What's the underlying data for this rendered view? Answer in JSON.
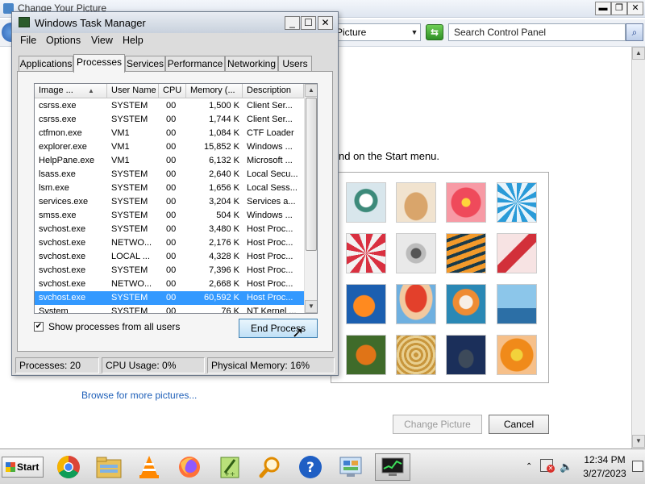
{
  "control_panel": {
    "window_title": "Change Your Picture",
    "address_text": "Picture",
    "search_placeholder": "Search Control Panel",
    "instruction": "nd on the Start menu.",
    "browse_link": "Browse for more pictures...",
    "change_button": "Change Picture",
    "cancel_button": "Cancel"
  },
  "task_manager": {
    "title": "Windows Task Manager",
    "menu": [
      "File",
      "Options",
      "View",
      "Help"
    ],
    "tabs": [
      "Applications",
      "Processes",
      "Services",
      "Performance",
      "Networking",
      "Users"
    ],
    "active_tab": "Processes",
    "columns": [
      "Image ...",
      "User Name",
      "CPU",
      "Memory (...",
      "Description"
    ],
    "processes": [
      {
        "image": "csrss.exe",
        "user": "SYSTEM",
        "cpu": "00",
        "memory": "1,500 K",
        "desc": "Client Ser..."
      },
      {
        "image": "csrss.exe",
        "user": "SYSTEM",
        "cpu": "00",
        "memory": "1,744 K",
        "desc": "Client Ser..."
      },
      {
        "image": "ctfmon.exe",
        "user": "VM1",
        "cpu": "00",
        "memory": "1,084 K",
        "desc": "CTF Loader"
      },
      {
        "image": "explorer.exe",
        "user": "VM1",
        "cpu": "00",
        "memory": "15,852 K",
        "desc": "Windows ..."
      },
      {
        "image": "HelpPane.exe",
        "user": "VM1",
        "cpu": "00",
        "memory": "6,132 K",
        "desc": "Microsoft ..."
      },
      {
        "image": "lsass.exe",
        "user": "SYSTEM",
        "cpu": "00",
        "memory": "2,640 K",
        "desc": "Local Secu..."
      },
      {
        "image": "lsm.exe",
        "user": "SYSTEM",
        "cpu": "00",
        "memory": "1,656 K",
        "desc": "Local Sess..."
      },
      {
        "image": "services.exe",
        "user": "SYSTEM",
        "cpu": "00",
        "memory": "3,204 K",
        "desc": "Services a..."
      },
      {
        "image": "smss.exe",
        "user": "SYSTEM",
        "cpu": "00",
        "memory": "504 K",
        "desc": "Windows ..."
      },
      {
        "image": "svchost.exe",
        "user": "SYSTEM",
        "cpu": "00",
        "memory": "3,480 K",
        "desc": "Host Proc..."
      },
      {
        "image": "svchost.exe",
        "user": "NETWO...",
        "cpu": "00",
        "memory": "2,176 K",
        "desc": "Host Proc..."
      },
      {
        "image": "svchost.exe",
        "user": "LOCAL ...",
        "cpu": "00",
        "memory": "4,328 K",
        "desc": "Host Proc..."
      },
      {
        "image": "svchost.exe",
        "user": "SYSTEM",
        "cpu": "00",
        "memory": "7,396 K",
        "desc": "Host Proc..."
      },
      {
        "image": "svchost.exe",
        "user": "NETWO...",
        "cpu": "00",
        "memory": "2,668 K",
        "desc": "Host Proc..."
      },
      {
        "image": "svchost.exe",
        "user": "SYSTEM",
        "cpu": "00",
        "memory": "60,592 K",
        "desc": "Host Proc..."
      },
      {
        "image": "System",
        "user": "SYSTEM",
        "cpu": "00",
        "memory": "76 K",
        "desc": "NT Kernel ..."
      }
    ],
    "selected_index": 14,
    "show_all_label": "Show processes from all users",
    "show_all_checked": true,
    "end_process_label": "End Process",
    "status": {
      "processes": "Processes: 20",
      "cpu": "CPU Usage: 0%",
      "memory": "Physical Memory: 16%"
    }
  },
  "taskbar": {
    "start_label": "Start",
    "pinned_icons": [
      "chrome-icon",
      "file-explorer-icon",
      "vlc-icon",
      "firefox-icon",
      "notepadpp-icon",
      "search-magnifier-icon",
      "help-icon",
      "control-panel-icon",
      "task-manager-icon"
    ],
    "time": "12:34 PM",
    "date": "3/27/2023"
  },
  "colors": {
    "selection": "#3399ff",
    "link": "#1e5fb8",
    "window_chrome": "#dcdcdc"
  }
}
